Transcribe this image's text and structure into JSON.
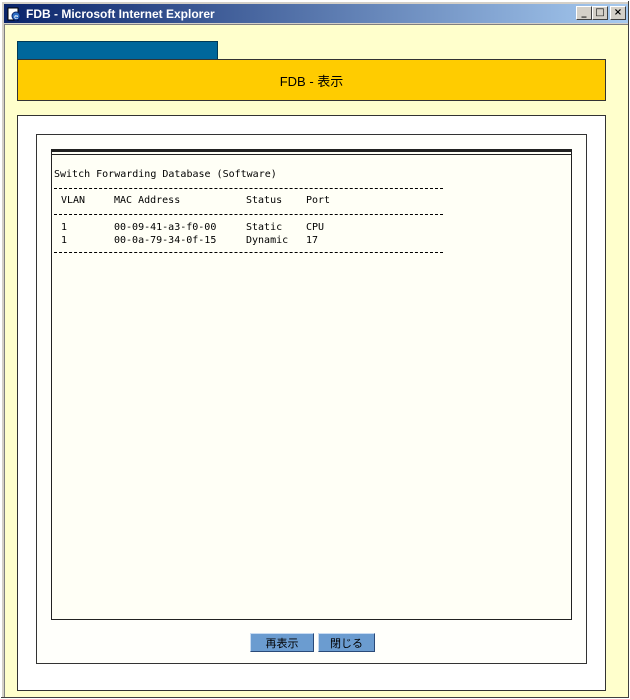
{
  "window": {
    "title": "FDB - Microsoft Internet Explorer",
    "buttons": {
      "minimize": "_",
      "maximize": "□",
      "close": "×"
    }
  },
  "page": {
    "title": "FDB - 表示"
  },
  "fdb": {
    "heading": "Switch Forwarding Database (Software)",
    "columns": {
      "vlan": "VLAN",
      "mac": "MAC Address",
      "status": "Status",
      "port": "Port"
    },
    "rows": [
      {
        "vlan": "1",
        "mac": "00-09-41-a3-f0-00",
        "status": "Static",
        "port": "CPU"
      },
      {
        "vlan": "1",
        "mac": "00-0a-79-34-0f-15",
        "status": "Dynamic",
        "port": "17"
      }
    ]
  },
  "actions": {
    "refresh": "再表示",
    "close": "閉じる"
  },
  "colors": {
    "titlebar_start": "#0a246a",
    "page_background": "#ffffcc",
    "tab": "#00679b",
    "header_band": "#ffcc00",
    "button": "#6b9cd0"
  }
}
